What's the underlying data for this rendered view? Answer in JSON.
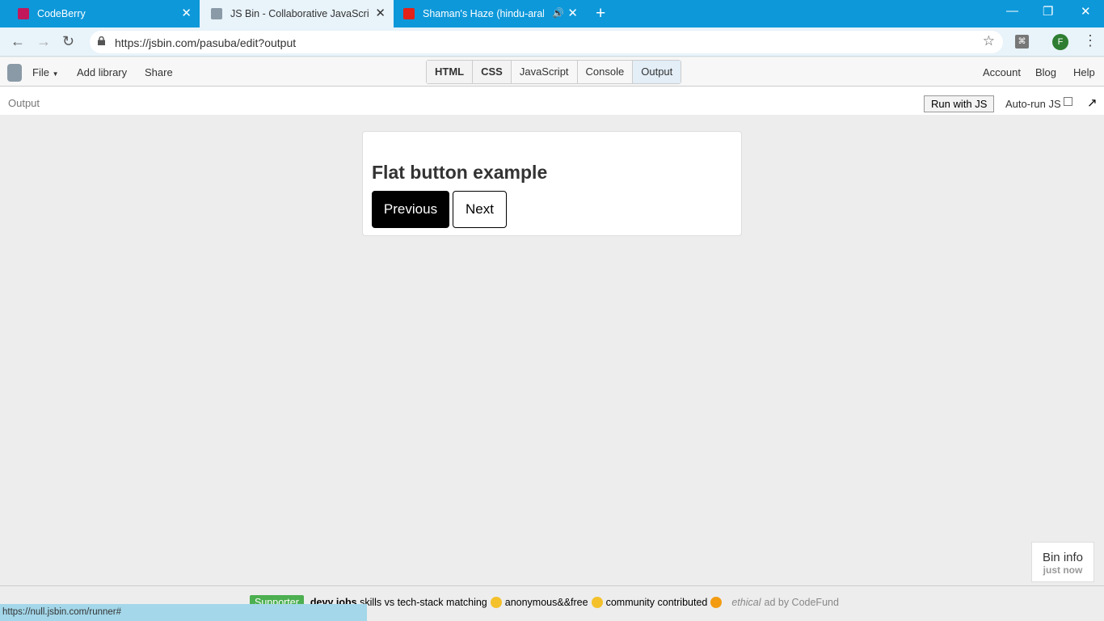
{
  "browser": {
    "tabs": [
      {
        "title": "CodeBerry",
        "active": false
      },
      {
        "title": "JS Bin - Collaborative JavaScript Debugging",
        "active": true
      },
      {
        "title": "Shaman's Haze (hindu-arab dub)",
        "active": false
      }
    ],
    "url": "https://jsbin.com/pasuba/edit?output",
    "profile_initial": "F"
  },
  "jsbin": {
    "menu": {
      "file": "File",
      "add_library": "Add library",
      "share": "Share"
    },
    "panels": [
      "HTML",
      "CSS",
      "JavaScript",
      "Console",
      "Output"
    ],
    "right_menu": {
      "account": "Account",
      "blog": "Blog",
      "help": "Help"
    },
    "output_label": "Output",
    "run_button": "Run with JS",
    "autorun_label": "Auto-run JS",
    "autorun_checked": false,
    "bin_info": {
      "title": "Bin info",
      "subtitle": "just now"
    }
  },
  "output": {
    "heading": "Flat button example",
    "prev_button": "Previous",
    "next_button": "Next"
  },
  "ad": {
    "badge": "Supporter",
    "title": "devy jobs",
    "text1": "skills vs tech-stack matching",
    "text2": "anonymous&&free",
    "text3": "community contributed",
    "ethical": "ethical",
    "by": "ad by CodeFund"
  },
  "status_url": "https://null.jsbin.com/runner#",
  "colors": {
    "tabbar": "#0d98da",
    "supporter": "#4caf50",
    "statusbar": "#a3d7e9"
  }
}
